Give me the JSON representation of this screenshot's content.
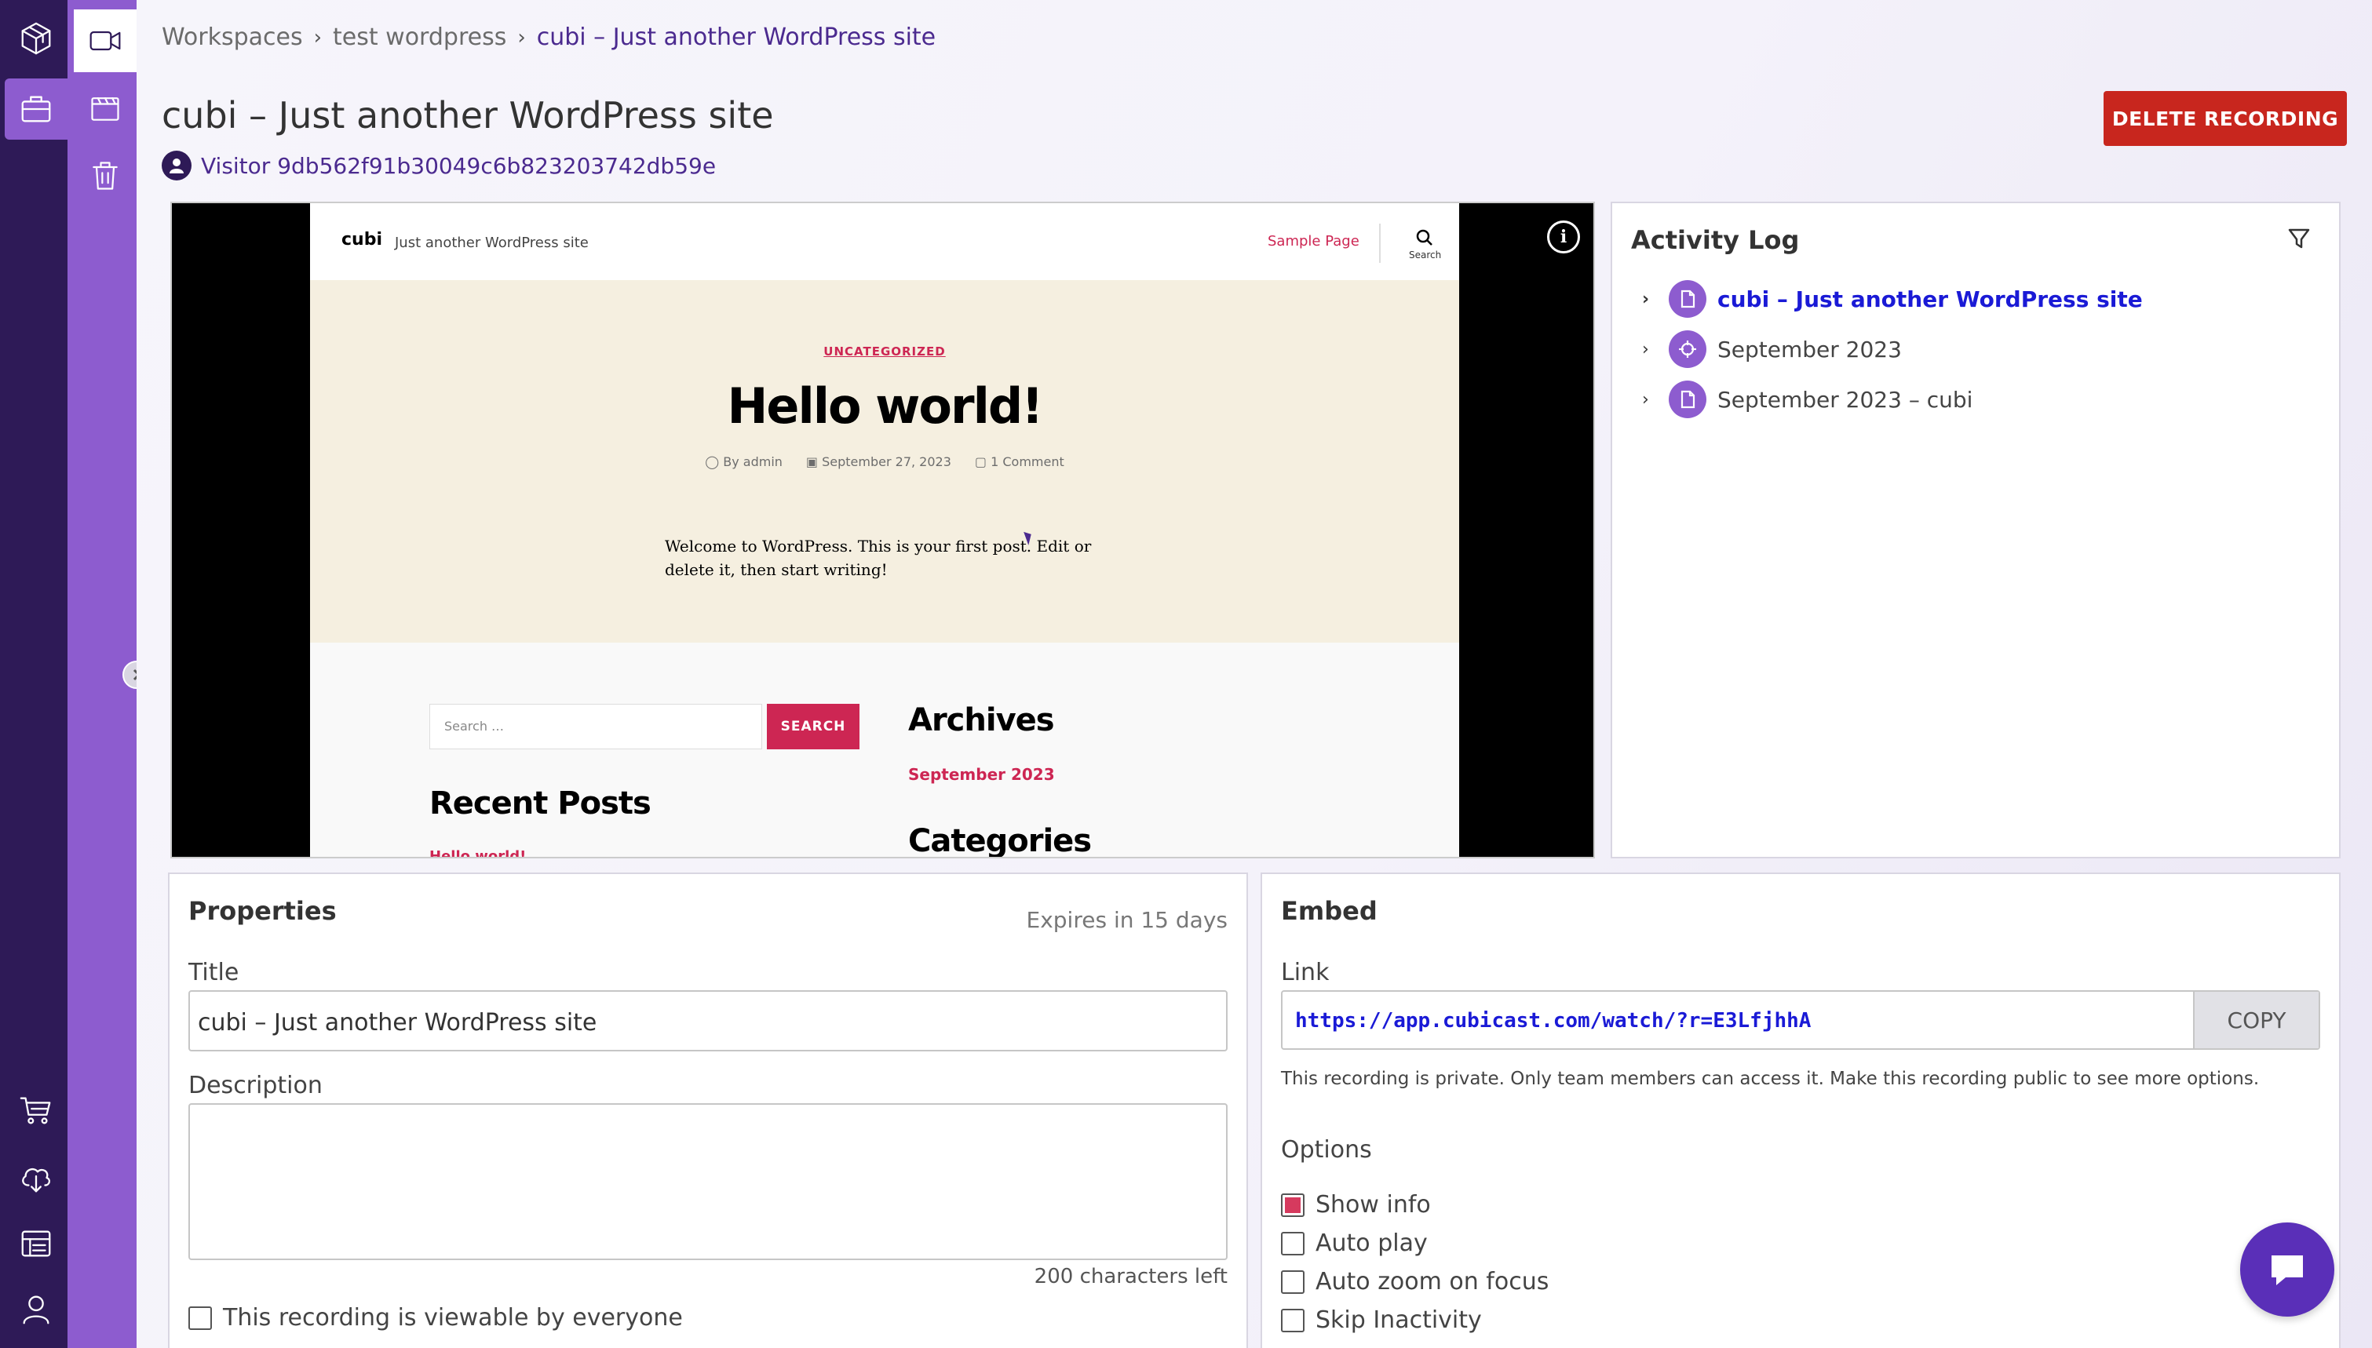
{
  "breadcrumb": {
    "items": [
      "Workspaces",
      "test wordpress",
      "cubi – Just another WordPress site"
    ],
    "separator": "›"
  },
  "page": {
    "title": "cubi – Just another WordPress site",
    "visitor": "Visitor 9db562f91b30049c6b823203742db59e",
    "delete_label": "DELETE RECORDING"
  },
  "rail": {
    "icons": [
      "cube-logo-icon",
      "briefcase-icon",
      "cart-icon",
      "cloud-download-icon",
      "reports-icon",
      "user-icon"
    ],
    "active": "briefcase-icon"
  },
  "subrail": {
    "icons": [
      "video-icon",
      "clapperboard-icon",
      "trash-icon"
    ],
    "active": "video-icon"
  },
  "recording": {
    "site_logo": "cubi",
    "site_tagline": "Just another WordPress site",
    "nav_link": "Sample Page",
    "search_icon_label": "Search",
    "category": "UNCATEGORIZED",
    "post_title": "Hello world!",
    "meta_author": "By admin",
    "meta_date": "September 27, 2023",
    "meta_comments": "1 Comment",
    "content": "Welcome to WordPress. This is your first post. Edit or delete it, then start writing!",
    "search_placeholder": "Search …",
    "search_button": "SEARCH",
    "recent_posts_heading": "Recent Posts",
    "recent_post_link": "Hello world!",
    "archives_heading": "Archives",
    "archive_link": "September 2023",
    "categories_heading": "Categories"
  },
  "activity_log": {
    "title": "Activity Log",
    "items": [
      {
        "label": "cubi – Just another WordPress site",
        "icon": "page-icon"
      },
      {
        "label": "September 2023",
        "icon": "crosshair-icon"
      },
      {
        "label": "September 2023 – cubi",
        "icon": "page-icon"
      }
    ]
  },
  "properties": {
    "title": "Properties",
    "expires": "Expires in 15 days",
    "title_label": "Title",
    "title_value": "cubi – Just another WordPress site",
    "description_label": "Description",
    "description_value": "",
    "chars_left": "200 characters left",
    "public_checkbox_label": "This recording is viewable by everyone",
    "public_checked": false
  },
  "embed": {
    "title": "Embed",
    "link_label": "Link",
    "link_value": "https://app.cubicast.com/watch/?r=E3LfjhhA",
    "copy_label": "COPY",
    "note": "This recording is private. Only team members can access it. Make this recording public to see more options.",
    "options_label": "Options",
    "options": [
      {
        "label": "Show info",
        "checked": true
      },
      {
        "label": "Auto play",
        "checked": false
      },
      {
        "label": "Auto zoom on focus",
        "checked": false
      },
      {
        "label": "Skip Inactivity",
        "checked": false
      }
    ]
  },
  "colors": {
    "rail": "#2e1a57",
    "subrail": "#8d5ccf",
    "danger": "#c8261e",
    "accent": "#4b2a8f",
    "wp_accent": "#cd2653"
  }
}
